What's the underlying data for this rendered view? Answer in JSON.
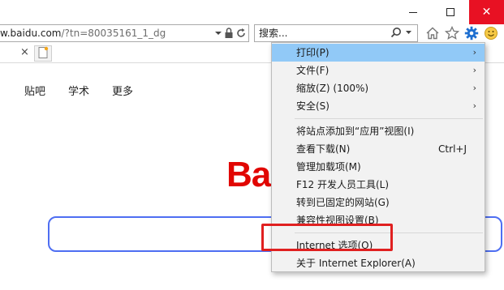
{
  "window": {
    "close_glyph": "✕"
  },
  "address_bar": {
    "url_host": "w.baidu.com",
    "url_path": "/?tn=80035161_1_dg"
  },
  "search_bar": {
    "placeholder": "搜索..."
  },
  "tab_row": {
    "close_glyph": "×"
  },
  "page": {
    "nav_links": [
      "贴吧",
      "学术",
      "更多"
    ],
    "logo_text": "Bai"
  },
  "tools_menu": {
    "items": [
      {
        "label": "打印(P)",
        "submenu": true,
        "highlighted": true
      },
      {
        "label": "文件(F)",
        "submenu": true
      },
      {
        "label": "缩放(Z) (100%)",
        "submenu": true
      },
      {
        "label": "安全(S)",
        "submenu": true
      },
      {
        "label": "将站点添加到“应用”视图(I)"
      },
      {
        "label": "查看下载(N)",
        "shortcut": "Ctrl+J"
      },
      {
        "label": "管理加载项(M)"
      },
      {
        "label": "F12 开发人员工具(L)"
      },
      {
        "label": "转到已固定的网站(G)"
      },
      {
        "label": "兼容性视图设置(B)"
      },
      {
        "label": "Internet 选项(O)"
      },
      {
        "label": "关于 Internet Explorer(A)"
      }
    ],
    "arrow_glyph": "›"
  },
  "colors": {
    "menu_highlight": "#91c9f7",
    "annotation_box": "#e02020",
    "logo": "#e10602",
    "search_border": "#4e6ef2",
    "close_button": "#e81123"
  }
}
